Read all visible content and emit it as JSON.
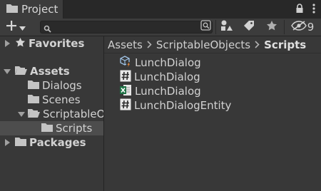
{
  "window": {
    "tab_title": "Project",
    "hidden_count": "9"
  },
  "toolbar": {
    "search_placeholder": ""
  },
  "tree": {
    "favorites": "Favorites",
    "assets": "Assets",
    "dialogs": "Dialogs",
    "scenes": "Scenes",
    "scriptable_objects": "ScriptableO",
    "scripts": "Scripts",
    "packages": "Packages"
  },
  "breadcrumb": {
    "items": [
      "Assets",
      "ScriptableObjects",
      "Scripts"
    ]
  },
  "files": [
    {
      "name": "LunchDialog",
      "icon": "scriptable-object-icon"
    },
    {
      "name": "LunchDialog",
      "icon": "csharp-script-icon"
    },
    {
      "name": "LunchDialog",
      "icon": "excel-file-icon"
    },
    {
      "name": "LunchDialogEntity",
      "icon": "csharp-script-icon"
    }
  ],
  "colors": {
    "background": "#383838",
    "tabbar": "#282828",
    "selected_row": "#4d4d4d",
    "folder": "#c4c4c4",
    "excel_green": "#1e7145"
  }
}
